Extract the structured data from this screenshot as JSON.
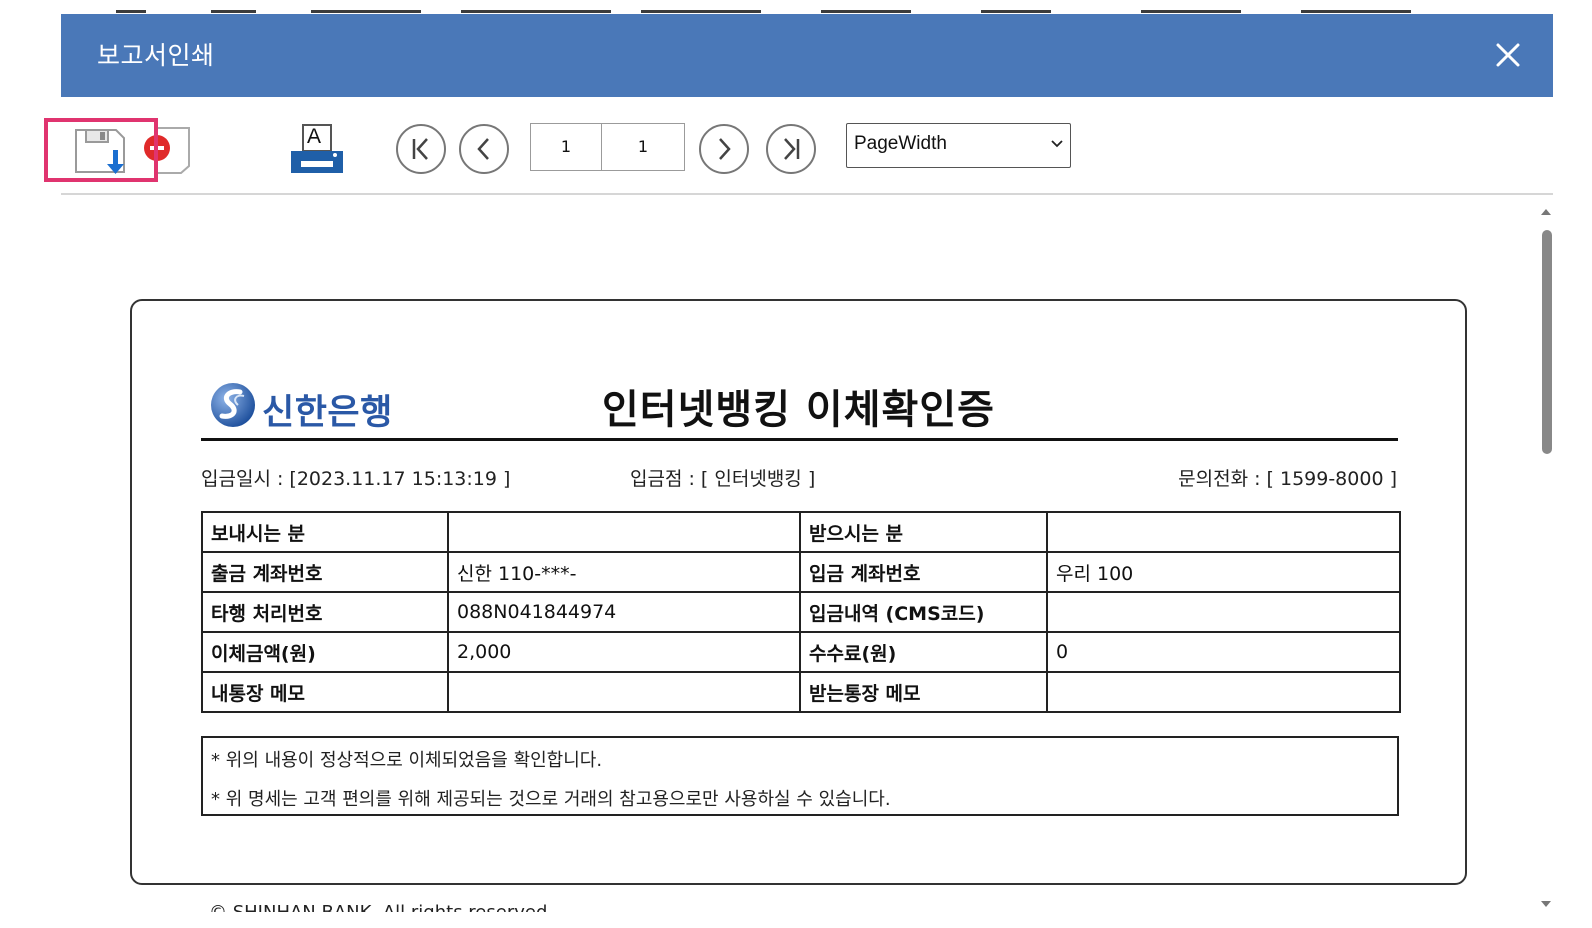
{
  "dialog": {
    "title": "보고서인쇄"
  },
  "toolbar": {
    "print_icon_letter": "A",
    "page_current": "1",
    "page_total": "1",
    "zoom_value": "PageWidth"
  },
  "report": {
    "bank_name": "신한은행",
    "title": "인터넷뱅킹 이체확인증",
    "deposit_datetime": "입금일시 : [2023.11.17 15:13:19 ]",
    "deposit_branch": "입금점 : [ 인터넷뱅킹 ]",
    "inquiry_phone": "문의전화 : [ 1599-8000 ]",
    "rows": [
      {
        "l_label": "보내시는 분",
        "l_value": "",
        "r_label": "받으시는 분",
        "r_value": ""
      },
      {
        "l_label": "출금 계좌번호",
        "l_value": "신한 110-***-",
        "r_label": "입금 계좌번호",
        "r_value": "우리 100"
      },
      {
        "l_label": "타행 처리번호",
        "l_value": "088N041844974",
        "r_label": "입금내역 (CMS코드)",
        "r_value": ""
      },
      {
        "l_label": "이체금액(원)",
        "l_value": "2,000",
        "r_label": "수수료(원)",
        "r_value": "0"
      },
      {
        "l_label": "내통장 메모",
        "l_value": "",
        "r_label": "받는통장 메모",
        "r_value": ""
      }
    ],
    "notes": [
      "* 위의 내용이 정상적으로 이체되었음을 확인합니다.",
      "* 위 명세는 고객 편의를 위해 제공되는 것으로 거래의 참고용으로만 사용하실 수 있습니다."
    ],
    "copyright": "© SHINHAN BANK. All rights reserved."
  },
  "colors": {
    "titlebar": "#4a78b8",
    "highlight": "#e0346f",
    "bank_blue": "#2a58a6"
  },
  "icons": [
    "close-icon",
    "save-icon",
    "export-pdf-icon",
    "print-icon",
    "first-page-icon",
    "prev-page-icon",
    "next-page-icon",
    "last-page-icon",
    "dropdown-chevron-icon",
    "scroll-up-icon",
    "scroll-down-icon"
  ]
}
